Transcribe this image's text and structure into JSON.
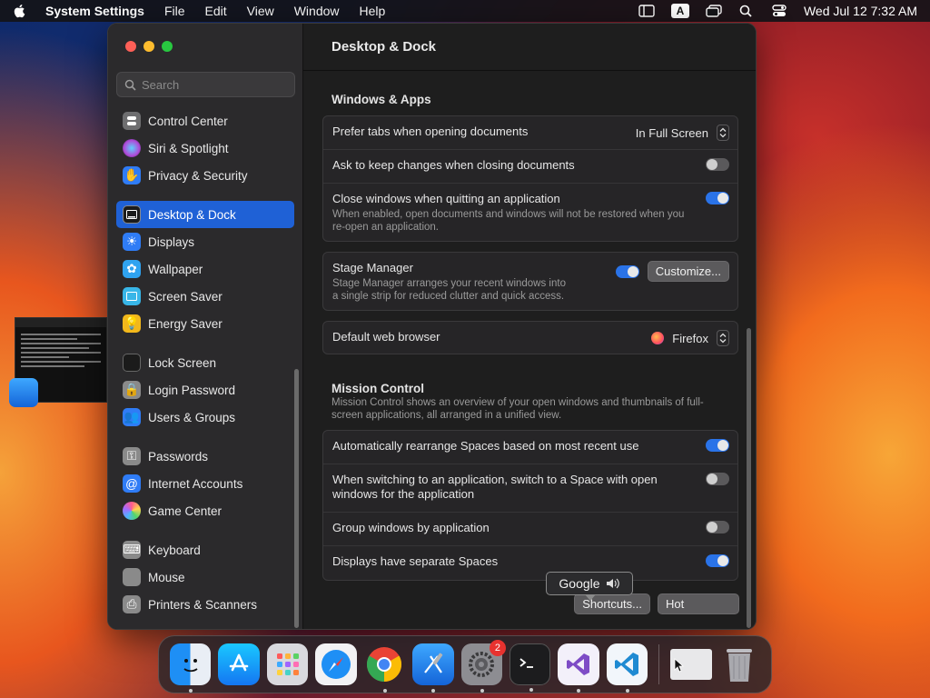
{
  "menubar": {
    "app": "System Settings",
    "menus": [
      "File",
      "Edit",
      "View",
      "Window",
      "Help"
    ],
    "input_indicator": "A",
    "datetime": "Wed Jul 12  7:32 AM"
  },
  "sidebar": {
    "search_placeholder": "Search",
    "items": [
      {
        "label": "Control Center",
        "icon": "control-center-icon",
        "color": "#7a7a7a"
      },
      {
        "label": "Siri & Spotlight",
        "icon": "siri-icon",
        "color": "#b04ad8"
      },
      {
        "label": "Privacy & Security",
        "icon": "hand-icon",
        "color": "#2f7cf6"
      },
      {
        "label": "Desktop & Dock",
        "icon": "dock-icon",
        "color": "#1b1b1b",
        "active": true
      },
      {
        "label": "Displays",
        "icon": "sun-icon",
        "color": "#2f7cf6"
      },
      {
        "label": "Wallpaper",
        "icon": "wallpaper-icon",
        "color": "#2fa3f0"
      },
      {
        "label": "Screen Saver",
        "icon": "screen-saver-icon",
        "color": "#38b6e8"
      },
      {
        "label": "Energy Saver",
        "icon": "battery-icon",
        "color": "#f2b81b"
      },
      {
        "label": "Lock Screen",
        "icon": "lock-screen-icon",
        "color": "#1b1b1b"
      },
      {
        "label": "Login Password",
        "icon": "lock-icon",
        "color": "#8a8a8a"
      },
      {
        "label": "Users & Groups",
        "icon": "users-icon",
        "color": "#2f7cf6"
      },
      {
        "label": "Passwords",
        "icon": "key-icon",
        "color": "#8a8a8a"
      },
      {
        "label": "Internet Accounts",
        "icon": "at-icon",
        "color": "#2f7cf6"
      },
      {
        "label": "Game Center",
        "icon": "game-center-icon",
        "color": "#ffffff"
      },
      {
        "label": "Keyboard",
        "icon": "keyboard-icon",
        "color": "#8a8a8a"
      },
      {
        "label": "Mouse",
        "icon": "mouse-icon",
        "color": "#8a8a8a"
      },
      {
        "label": "Printers & Scanners",
        "icon": "printer-icon",
        "color": "#8a8a8a"
      }
    ]
  },
  "main": {
    "title": "Desktop & Dock",
    "windows_apps": {
      "title": "Windows & Apps",
      "prefer_tabs": {
        "label": "Prefer tabs when opening documents",
        "value": "In Full Screen"
      },
      "ask_keep": {
        "label": "Ask to keep changes when closing documents",
        "on": false
      },
      "close_windows": {
        "label": "Close windows when quitting an application",
        "desc": "When enabled, open documents and windows will not be restored when you re-open an application.",
        "on": true
      }
    },
    "stage_manager": {
      "label": "Stage Manager",
      "desc": "Stage Manager arranges your recent windows into a single strip for reduced clutter and quick access.",
      "on": true,
      "button": "Customize..."
    },
    "browser": {
      "label": "Default web browser",
      "value": "Firefox"
    },
    "mission_control": {
      "title": "Mission Control",
      "desc": "Mission Control shows an overview of your open windows and thumbnails of full-screen applications, all arranged in a unified view.",
      "auto_rearrange": {
        "label": "Automatically rearrange Spaces based on most recent use",
        "on": true
      },
      "switch_space": {
        "label": "When switching to an application, switch to a Space with open windows for the application",
        "on": false
      },
      "group_windows": {
        "label": "Group windows by application",
        "on": false
      },
      "separate_spaces": {
        "label": "Displays have separate Spaces",
        "on": true
      }
    },
    "bottom": {
      "shortcuts": "Shortcuts...",
      "hot_corners": "Hot"
    }
  },
  "tooltip": {
    "text": "Google"
  },
  "dock": {
    "items": [
      "Finder",
      "App Store",
      "Launchpad",
      "Safari",
      "Chrome",
      "Xcode",
      "System Settings",
      "Terminal",
      "Visual Studio",
      "VS Code"
    ],
    "settings_badge": "2"
  }
}
